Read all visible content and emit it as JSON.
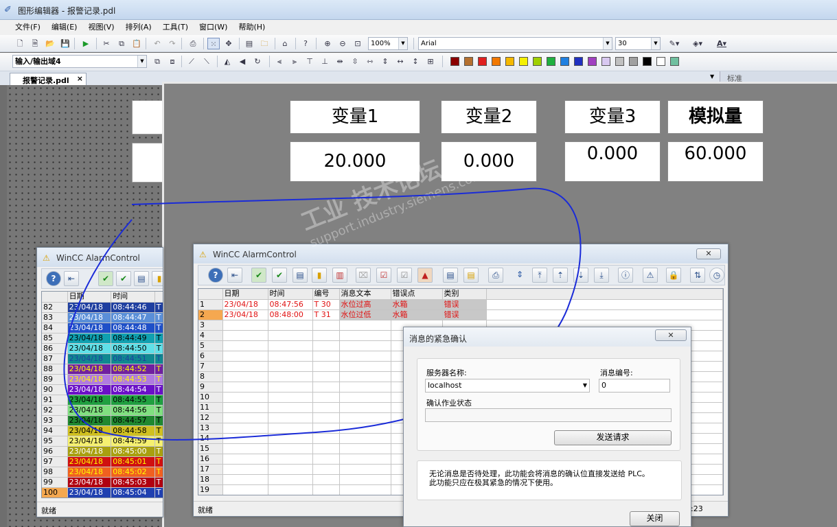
{
  "window": {
    "title": "图形编辑器 - 报警记录.pdl"
  },
  "menu": [
    "文件(F)",
    "编辑(E)",
    "视图(V)",
    "排列(A)",
    "工具(T)",
    "窗口(W)",
    "帮助(H)"
  ],
  "toolbar": {
    "zoom": "100%",
    "font": "Arial",
    "font_size": "30",
    "object_name": "输入/输出域4",
    "palette": [
      "#8b0000",
      "#b5702f",
      "#e02020",
      "#f27800",
      "#f5b800",
      "#f5f000",
      "#a0d000",
      "#20b040",
      "#2080e0",
      "#2030c0",
      "#a040c0",
      "#d8c8f0",
      "#c0c0c0",
      "#a0a0a0",
      "#000000",
      "#ffffff",
      "#70c0a0"
    ]
  },
  "tab": {
    "label": "报警记录.pdl",
    "close": "×"
  },
  "right_panel": {
    "label": "标准"
  },
  "variables": {
    "labels": [
      "变量1",
      "变量2",
      "变量3",
      "模拟量"
    ],
    "values": [
      "20.000",
      "0.000",
      "0.000",
      "60.000"
    ]
  },
  "alarm_left": {
    "title": "WinCC AlarmControl",
    "headers": [
      "日期",
      "时间"
    ],
    "rows": [
      {
        "n": "82",
        "date": "23/04/18",
        "time": "08:44:46",
        "c": "T",
        "bg": "#1f3fa0",
        "fg": "#ffffff"
      },
      {
        "n": "83",
        "date": "23/04/18",
        "time": "08:44:47",
        "c": "T",
        "bg": "#5a8fd8",
        "fg": "#ffffff"
      },
      {
        "n": "84",
        "date": "23/04/18",
        "time": "08:44:48",
        "c": "T",
        "bg": "#1f50c8",
        "fg": "#ffffff"
      },
      {
        "n": "85",
        "date": "23/04/18",
        "time": "08:44:49",
        "c": "T",
        "bg": "#10a0b0",
        "fg": "#000000"
      },
      {
        "n": "86",
        "date": "23/04/18",
        "time": "08:44:50",
        "c": "T",
        "bg": "#60e0e8",
        "fg": "#000000"
      },
      {
        "n": "87",
        "date": "23/04/18",
        "time": "08:44:51",
        "c": "T",
        "bg": "#108890",
        "fg": "#1f3fa0"
      },
      {
        "n": "88",
        "date": "23/04/18",
        "time": "08:44:52",
        "c": "T",
        "bg": "#7020a0",
        "fg": "#ffff00"
      },
      {
        "n": "89",
        "date": "23/04/18",
        "time": "08:44:53",
        "c": "T",
        "bg": "#b07ae0",
        "fg": "#ffff00"
      },
      {
        "n": "90",
        "date": "23/04/18",
        "time": "08:44:54",
        "c": "T",
        "bg": "#6a10c8",
        "fg": "#ffffff"
      },
      {
        "n": "91",
        "date": "23/04/18",
        "time": "08:44:55",
        "c": "T",
        "bg": "#20a040",
        "fg": "#000000"
      },
      {
        "n": "92",
        "date": "23/04/18",
        "time": "08:44:56",
        "c": "T",
        "bg": "#80e080",
        "fg": "#000000"
      },
      {
        "n": "93",
        "date": "23/04/18",
        "time": "08:44:57",
        "c": "T",
        "bg": "#208830",
        "fg": "#000000"
      },
      {
        "n": "94",
        "date": "23/04/18",
        "time": "08:44:58",
        "c": "T",
        "bg": "#d0c020",
        "fg": "#000000"
      },
      {
        "n": "95",
        "date": "23/04/18",
        "time": "08:44:59",
        "c": "T",
        "bg": "#f5f070",
        "fg": "#000000"
      },
      {
        "n": "96",
        "date": "23/04/18",
        "time": "08:45:00",
        "c": "T",
        "bg": "#a8a010",
        "fg": "#ffffff"
      },
      {
        "n": "97",
        "date": "23/04/18",
        "time": "08:45:01",
        "c": "T",
        "bg": "#d01010",
        "fg": "#ffff00"
      },
      {
        "n": "98",
        "date": "23/04/18",
        "time": "08:45:02",
        "c": "T",
        "bg": "#f06020",
        "fg": "#ffff00"
      },
      {
        "n": "99",
        "date": "23/04/18",
        "time": "08:45:03",
        "c": "T",
        "bg": "#b00010",
        "fg": "#ffffff"
      },
      {
        "n": "100",
        "date": "23/04/18",
        "time": "08:45:04",
        "c": "T",
        "bg": "#2040b0",
        "fg": "#ffffff"
      }
    ],
    "status": "就绪"
  },
  "alarm_main": {
    "title": "WinCC AlarmControl",
    "headers": [
      "日期",
      "时间",
      "编号",
      "消息文本",
      "错误点",
      "类别"
    ],
    "rows": [
      {
        "n": "1",
        "date": "23/04/18",
        "time": "08:47:56",
        "num": "T 30",
        "text": "水位过高",
        "point": "水箱",
        "cat": "错误"
      },
      {
        "n": "2",
        "date": "23/04/18",
        "time": "08:48:00",
        "num": "T 31",
        "text": "水位过低",
        "point": "水箱",
        "cat": "错误"
      }
    ],
    "empty_rows": [
      "3",
      "4",
      "5",
      "6",
      "7",
      "8",
      "9",
      "10",
      "11",
      "12",
      "13",
      "14",
      "15",
      "16",
      "17",
      "18",
      "19"
    ],
    "status": "就绪",
    "status_time": ":23"
  },
  "dialog": {
    "title": "消息的紧急确认",
    "server_label": "服务器名称:",
    "server_value": "localhost",
    "msgno_label": "消息编号:",
    "msgno_value": "0",
    "status_label": "确认作业状态",
    "send_button": "发送请求",
    "note": "无论消息是否待处理，此功能会将消息的确认位直接发送给 PLC。\n此功能只应在极其紧急的情况下使用。",
    "close_button": "关闭"
  },
  "watermark": {
    "line1": "工业 技术论坛",
    "line2": "support.industry.siemens.com/cs"
  }
}
